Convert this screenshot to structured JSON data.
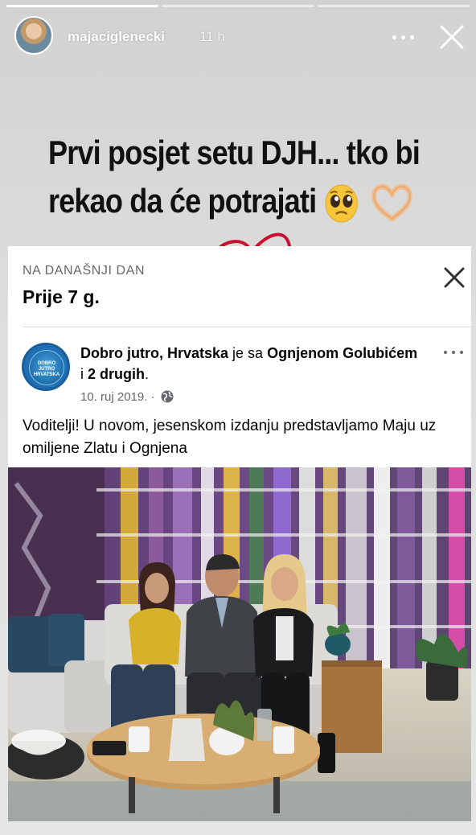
{
  "story": {
    "progress_segments": 3,
    "progress_done": 1,
    "username": "majaciglenecki",
    "time": "11 h",
    "caption_lines": [
      "Prvi posjet setu DJH... tko bi",
      "rekao da će potrajati"
    ],
    "caption_emojis": [
      "pleading-face-icon",
      "heart-hands-icon"
    ]
  },
  "memory": {
    "label": "NA DANAŠNJI DAN",
    "years_ago": "Prije 7 g.",
    "post": {
      "page_name": "Dobro jutro, Hrvatska",
      "with_text": " je sa ",
      "tagged": "Ognjenom Golubićem",
      "and_text": " i ",
      "others": "2 drugih",
      "end": ".",
      "date": "10. ruj 2019. ·",
      "text": "Voditelji! U novom, jesenskom izdanju  predstavljamo Maju uz omiljene Zlatu i Ognjena",
      "logo_text": [
        "DOBRO",
        "JUTRO",
        "HRVATSKA"
      ]
    }
  },
  "colors": {
    "heart": "#c8102e",
    "fb_secondary": "#65676b",
    "logo_blue": "#1f6fb2"
  }
}
